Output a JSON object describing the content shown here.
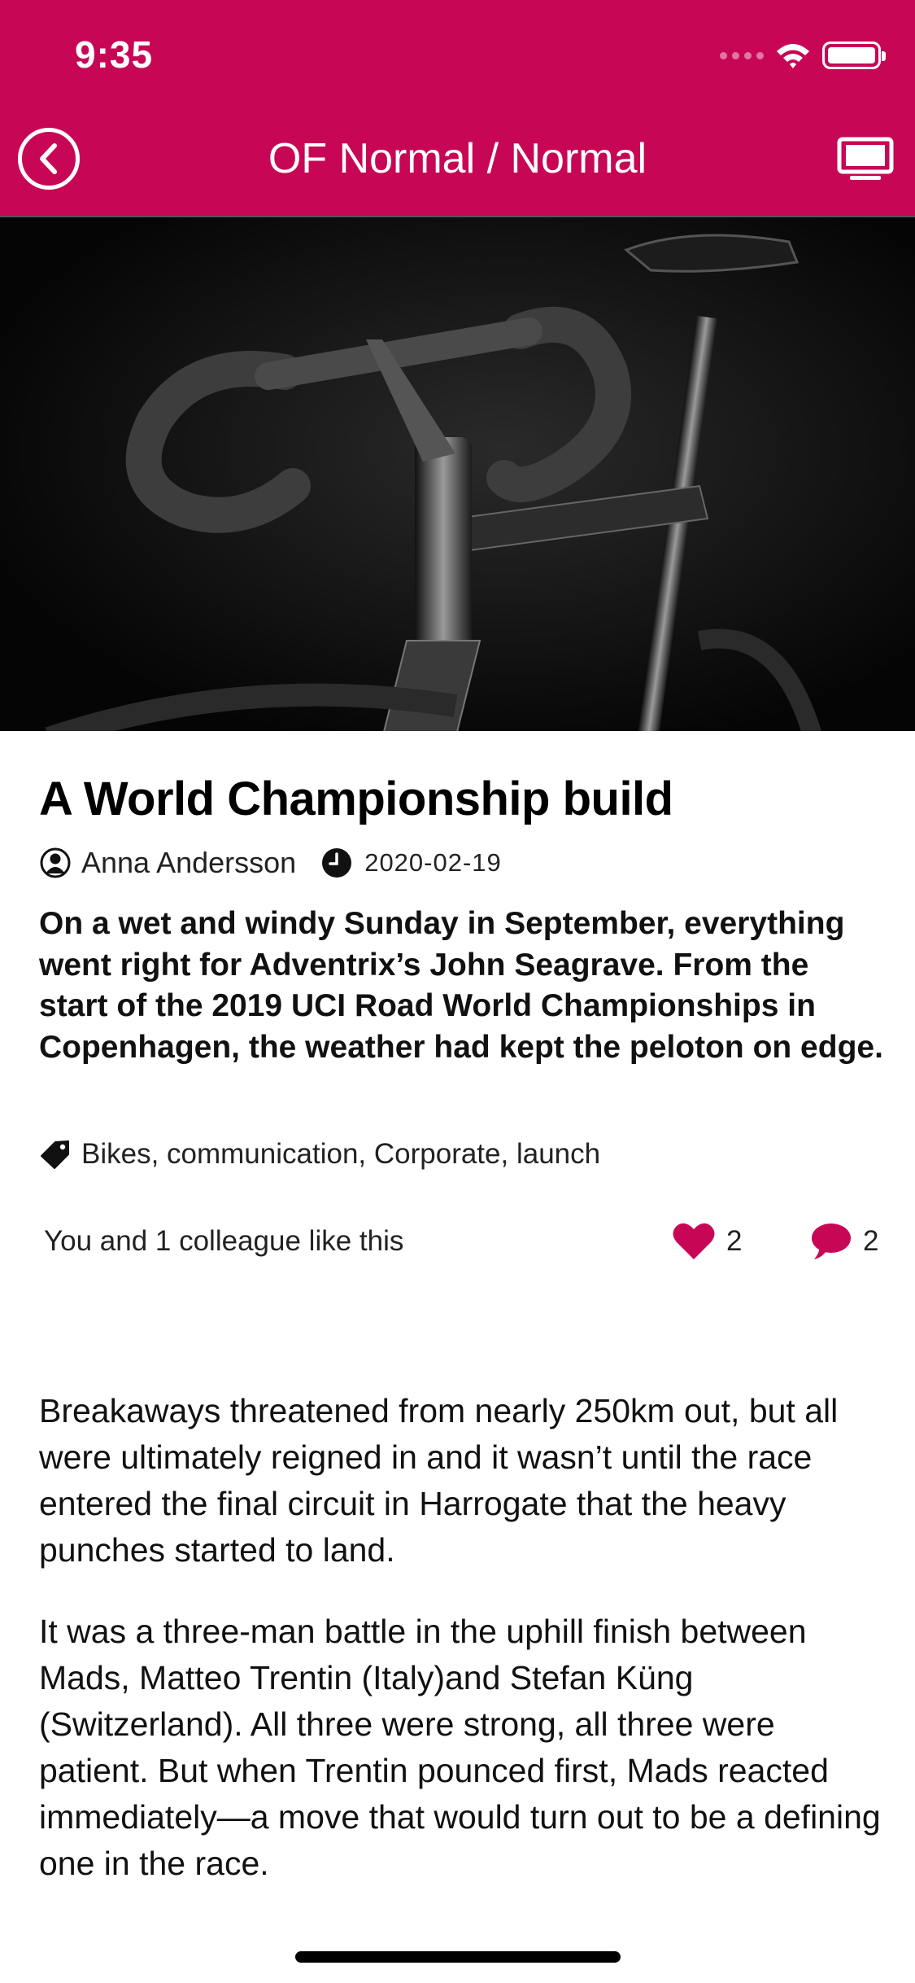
{
  "status_bar": {
    "time": "9:35"
  },
  "nav": {
    "title": "OF Normal / Normal"
  },
  "article": {
    "title": "A World Championship build",
    "author": "Anna Andersson",
    "date": "2020-02-19",
    "lead": "On a wet and windy Sunday in September, everything went right for Adventrix’s John Seagrave. From the start of the 2019 UCI Road World Championships in Copenhagen, the weather had kept the peloton on edge.",
    "tags": "Bikes, communication, Corporate, launch",
    "likes_text": "You and 1 colleague like this",
    "like_count": "2",
    "comment_count": "2",
    "body": [
      "Breakaways threatened from nearly 250km out, but all were ultimately reigned in and it wasn’t until the race entered the final circuit in Harrogate that the heavy punches started to land.",
      "It was a three-man battle in the uphill finish between Mads, Matteo Trentin (Italy)and Stefan Küng (Switzerland). All three were strong, all three were patient. But when Trentin pounced first, Mads reacted immediately—a move that would turn out to be a defining one in the race."
    ]
  },
  "icons": {
    "back": "chevron-left-circle-icon",
    "display": "monitor-icon",
    "author": "user-icon",
    "date": "clock-icon",
    "tags": "tag-icon",
    "like": "heart-icon",
    "comment": "speech-bubble-icon"
  },
  "colors": {
    "brand": "#c70755",
    "heart": "#c70755",
    "background": "#ffffff"
  }
}
